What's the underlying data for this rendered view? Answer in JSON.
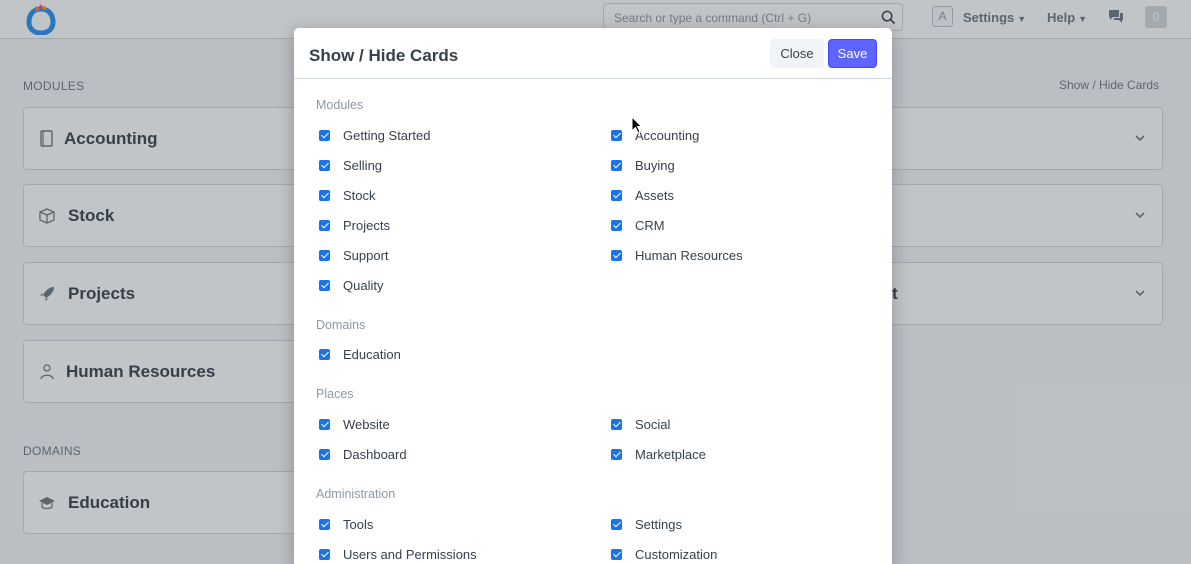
{
  "navbar": {
    "search_placeholder": "Search or type a command (Ctrl + G)",
    "avatar_initial": "A",
    "settings_label": "Settings",
    "help_label": "Help",
    "notification_count": "0"
  },
  "page": {
    "modules_label": "MODULES",
    "domains_label": "DOMAINS",
    "show_hide_link": "Show / Hide Cards",
    "cards": [
      {
        "title": "Accounting"
      },
      {
        "title": "Stock"
      },
      {
        "title": "Projects"
      },
      {
        "title": "Human Resources"
      },
      {
        "title": "Education"
      }
    ],
    "right_card_fragment": "t"
  },
  "modal": {
    "title": "Show / Hide Cards",
    "close_label": "Close",
    "save_label": "Save",
    "groups": [
      {
        "title": "Modules",
        "left": [
          "Getting Started",
          "Selling",
          "Stock",
          "Projects",
          "Support",
          "Quality"
        ],
        "right": [
          "Accounting",
          "Buying",
          "Assets",
          "CRM",
          "Human Resources"
        ]
      },
      {
        "title": "Domains",
        "left": [
          "Education"
        ],
        "right": []
      },
      {
        "title": "Places",
        "left": [
          "Website",
          "Dashboard"
        ],
        "right": [
          "Social",
          "Marketplace"
        ]
      },
      {
        "title": "Administration",
        "left": [
          "Tools",
          "Users and Permissions"
        ],
        "right": [
          "Settings",
          "Customization"
        ]
      }
    ]
  },
  "colors": {
    "primary": "#5e64ff",
    "checkbox": "#1a73e8",
    "text": "#36414c",
    "muted": "#8d99a6"
  }
}
